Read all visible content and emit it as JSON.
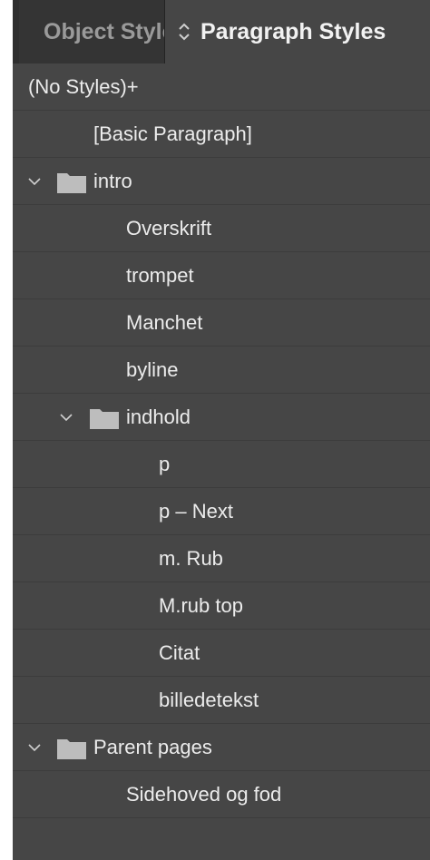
{
  "panel": {
    "tabs": [
      {
        "label": "Object Styles",
        "active": false
      },
      {
        "label": "Paragraph Styles",
        "active": true
      }
    ]
  },
  "styles_list": [
    {
      "label": "(No Styles)+",
      "type": "style",
      "level": 0
    },
    {
      "label": "[Basic Paragraph]",
      "type": "style",
      "level": 1
    },
    {
      "label": "intro",
      "type": "group",
      "expanded": true,
      "level": 0,
      "icon": "folder-icon"
    },
    {
      "label": "Overskrift",
      "type": "style",
      "level": 2
    },
    {
      "label": "trompet",
      "type": "style",
      "level": 2
    },
    {
      "label": "Manchet",
      "type": "style",
      "level": 2
    },
    {
      "label": "byline",
      "type": "style",
      "level": 2
    },
    {
      "label": "indhold",
      "type": "group",
      "expanded": true,
      "level": 1,
      "icon": "folder-icon"
    },
    {
      "label": "p",
      "type": "style",
      "level": 3
    },
    {
      "label": "p – Next",
      "type": "style",
      "level": 3
    },
    {
      "label": "m. Rub",
      "type": "style",
      "level": 3
    },
    {
      "label": "M.rub top",
      "type": "style",
      "level": 3
    },
    {
      "label": "Citat",
      "type": "style",
      "level": 3
    },
    {
      "label": "billedetekst",
      "type": "style",
      "level": 3
    },
    {
      "label": "Parent pages",
      "type": "group",
      "expanded": true,
      "level": 0,
      "icon": "folder-icon"
    },
    {
      "label": "Sidehoved og fod",
      "type": "style",
      "level": 2
    }
  ],
  "colors": {
    "panel_bg": "#464646",
    "tabbar_bg": "#2f2f2f",
    "text": "#ececec",
    "folder": "#bdbdbd"
  }
}
